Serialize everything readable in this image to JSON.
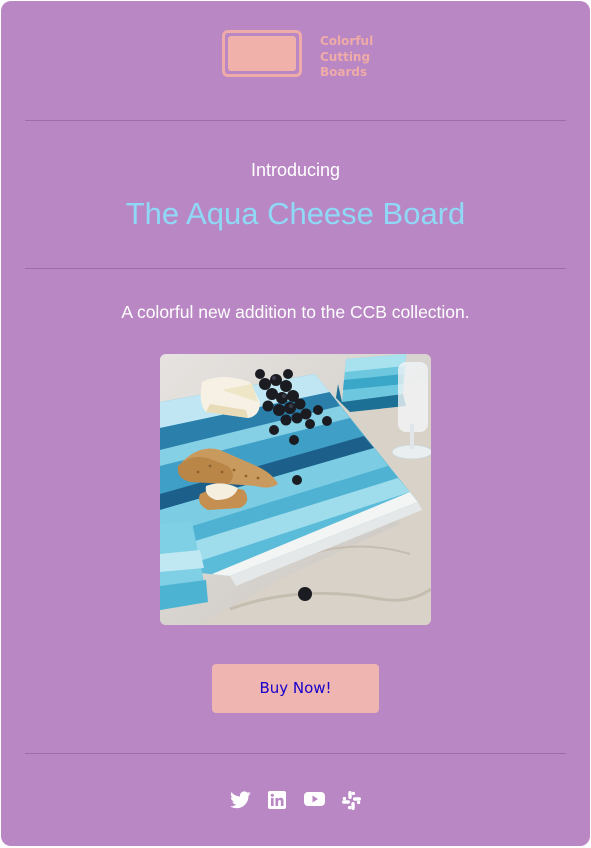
{
  "brand": {
    "name_lines": [
      "Colorful",
      "Cutting",
      "Boards"
    ],
    "color": "#eeaba8"
  },
  "hero": {
    "intro": "Introducing",
    "title": "The Aqua Cheese Board",
    "title_color": "#8fd9f7",
    "tagline": "A colorful new addition to the CCB collection."
  },
  "product_image": {
    "alt": "Aqua striped cheese board with cheese, crackers and grapes"
  },
  "cta": {
    "label": "Buy Now!",
    "background": "#efb5b0",
    "text_color": "#1500cc"
  },
  "social": [
    {
      "icon": "twitter-icon"
    },
    {
      "icon": "linkedin-icon"
    },
    {
      "icon": "youtube-icon"
    },
    {
      "icon": "slack-icon"
    }
  ],
  "colors": {
    "background": "#b987c3",
    "divider": "#9c6da7"
  }
}
